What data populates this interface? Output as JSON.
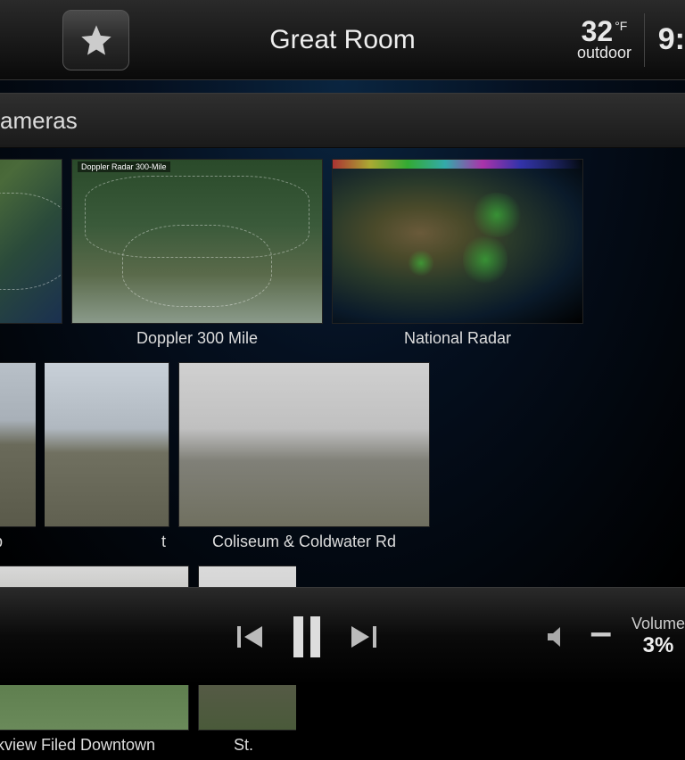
{
  "header": {
    "room_title": "Great Room",
    "temperature_value": "32",
    "temperature_unit": "°F",
    "temperature_label": "outdoor",
    "time": "9:"
  },
  "section": {
    "title": "ameras"
  },
  "cameras": [
    {
      "label": ""
    },
    {
      "label": "Doppler 300 Mile",
      "map_title": "Doppler Radar 300-Mile"
    },
    {
      "label": "National Radar"
    },
    {
      "label": "Dup"
    },
    {
      "label": "t"
    },
    {
      "label": "Coliseum & Coldwater Rd"
    },
    {
      "label": "Parkview Filed Downtown"
    },
    {
      "label": "St."
    }
  ],
  "footer": {
    "volume_label": "Volume",
    "volume_value": "3%"
  }
}
